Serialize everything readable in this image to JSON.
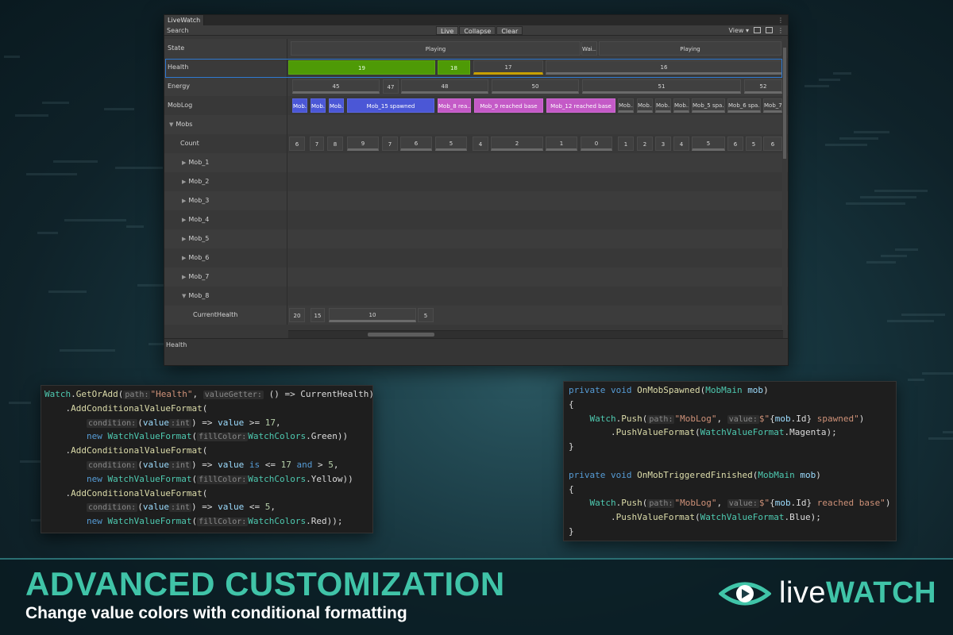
{
  "window": {
    "tab_title": "LiveWatch",
    "search_label": "Search",
    "toolbar": {
      "live": "Live",
      "collapse": "Collapse",
      "clear": "Clear",
      "view": "View ▾"
    },
    "footer_label": "Health",
    "menu_glyph": "⋮"
  },
  "rows": [
    {
      "label": "State",
      "indent": 0,
      "caret": ""
    },
    {
      "label": "Health",
      "indent": 0,
      "caret": ""
    },
    {
      "label": "Energy",
      "indent": 0,
      "caret": ""
    },
    {
      "label": "MobLog",
      "indent": 0,
      "caret": ""
    },
    {
      "label": "Mobs",
      "indent": 1,
      "caret": "▼"
    },
    {
      "label": "Count",
      "indent": 2,
      "caret": ""
    },
    {
      "label": "Mob_1",
      "indent": 3,
      "caret": "▶"
    },
    {
      "label": "Mob_2",
      "indent": 3,
      "caret": "▶"
    },
    {
      "label": "Mob_3",
      "indent": 3,
      "caret": "▶"
    },
    {
      "label": "Mob_4",
      "indent": 3,
      "caret": "▶"
    },
    {
      "label": "Mob_5",
      "indent": 3,
      "caret": "▶"
    },
    {
      "label": "Mob_6",
      "indent": 3,
      "caret": "▶"
    },
    {
      "label": "Mob_7",
      "indent": 3,
      "caret": "▶"
    },
    {
      "label": "Mob_8",
      "indent": 3,
      "caret": "▼"
    },
    {
      "label": "CurrentHealth",
      "indent": 4,
      "caret": ""
    }
  ],
  "cells": {
    "state": [
      {
        "text": "Playing",
        "style": ""
      },
      {
        "text": "Wai...",
        "style": ""
      },
      {
        "text": "Playing",
        "style": ""
      }
    ],
    "health": [
      {
        "text": "19",
        "style": "green"
      },
      {
        "text": "18",
        "style": "green"
      },
      {
        "text": "17",
        "style": "ybar"
      },
      {
        "text": "16",
        "style": "bar"
      }
    ],
    "energy": [
      {
        "text": "45",
        "style": "bar"
      },
      {
        "text": "47",
        "style": ""
      },
      {
        "text": "48",
        "style": "bar"
      },
      {
        "text": "50",
        "style": "bar"
      },
      {
        "text": "51",
        "style": "bar"
      },
      {
        "text": "52",
        "style": "bar"
      }
    ],
    "moblog": [
      {
        "text": "Mob...",
        "style": "blue"
      },
      {
        "text": "Mob...",
        "style": "blue"
      },
      {
        "text": "Mob...",
        "style": "blue"
      },
      {
        "text": "Mob_15 spawned",
        "style": "blue"
      },
      {
        "text": "Mob_8 rea...",
        "style": "magenta"
      },
      {
        "text": "Mob_9 reached base",
        "style": "magenta"
      },
      {
        "text": "Mob_12 reached base",
        "style": "magenta"
      },
      {
        "text": "Mob...",
        "style": "bar"
      },
      {
        "text": "Mob...",
        "style": "bar"
      },
      {
        "text": "Mob...",
        "style": "bar"
      },
      {
        "text": "Mob...",
        "style": "bar"
      },
      {
        "text": "Mob_5 spa...",
        "style": "bar"
      },
      {
        "text": "Mob_6 spa...",
        "style": "bar"
      },
      {
        "text": "Mob_7...",
        "style": "bar"
      }
    ],
    "count": [
      {
        "text": "6",
        "style": ""
      },
      {
        "text": "7",
        "style": ""
      },
      {
        "text": "8",
        "style": ""
      },
      {
        "text": "9",
        "style": "bar"
      },
      {
        "text": "7",
        "style": ""
      },
      {
        "text": "6",
        "style": "bar"
      },
      {
        "text": "5",
        "style": "bar"
      },
      {
        "text": "4",
        "style": ""
      },
      {
        "text": "2",
        "style": "bar"
      },
      {
        "text": "1",
        "style": "bar"
      },
      {
        "text": "0",
        "style": "bar"
      },
      {
        "text": "1",
        "style": ""
      },
      {
        "text": "2",
        "style": ""
      },
      {
        "text": "3",
        "style": ""
      },
      {
        "text": "4",
        "style": ""
      },
      {
        "text": "5",
        "style": "bar"
      },
      {
        "text": "6",
        "style": ""
      },
      {
        "text": "5",
        "style": ""
      },
      {
        "text": "6",
        "style": ""
      }
    ],
    "currenthealth": [
      {
        "text": "20",
        "style": ""
      },
      {
        "text": "15",
        "style": ""
      },
      {
        "text": "10",
        "style": "bar"
      },
      {
        "text": "5",
        "style": ""
      }
    ]
  },
  "code_left": [
    [
      [
        "ty",
        "Watch"
      ],
      [
        "",
        "."
      ],
      [
        "fn",
        "GetOrAdd"
      ],
      [
        "",
        "("
      ],
      [
        "hint",
        "path:"
      ],
      [
        "st",
        "\"Health\""
      ],
      [
        "",
        ", "
      ],
      [
        "hint",
        "valueGetter:"
      ],
      [
        "",
        " () => CurrentHealth)"
      ]
    ],
    [
      [
        "",
        "    ."
      ],
      [
        "fn",
        "AddConditionalValueFormat"
      ],
      [
        "",
        "("
      ]
    ],
    [
      [
        "",
        "        "
      ],
      [
        "hint",
        "condition:"
      ],
      [
        "",
        "("
      ],
      [
        "vr",
        "value"
      ],
      [
        "hint",
        ":int"
      ],
      [
        "",
        ") => "
      ],
      [
        "vr",
        "value"
      ],
      [
        "",
        " >= "
      ],
      [
        "nm",
        "17"
      ],
      [
        "",
        ","
      ]
    ],
    [
      [
        "",
        "        "
      ],
      [
        "kw",
        "new "
      ],
      [
        "ty",
        "WatchValueFormat"
      ],
      [
        "",
        "("
      ],
      [
        "hint",
        "fillColor:"
      ],
      [
        "ty",
        "WatchColors"
      ],
      [
        "",
        ".Green))"
      ]
    ],
    [
      [
        "",
        "    ."
      ],
      [
        "fn",
        "AddConditionalValueFormat"
      ],
      [
        "",
        "("
      ]
    ],
    [
      [
        "",
        "        "
      ],
      [
        "hint",
        "condition:"
      ],
      [
        "",
        "("
      ],
      [
        "vr",
        "value"
      ],
      [
        "hint",
        ":int"
      ],
      [
        "",
        ") => "
      ],
      [
        "vr",
        "value"
      ],
      [
        "",
        ""
      ],
      [
        "kw",
        " is"
      ],
      [
        "",
        " <= "
      ],
      [
        "nm",
        "17"
      ],
      [
        "kw",
        " and"
      ],
      [
        "",
        " > "
      ],
      [
        "nm",
        "5"
      ],
      [
        "",
        ","
      ]
    ],
    [
      [
        "",
        "        "
      ],
      [
        "kw",
        "new "
      ],
      [
        "ty",
        "WatchValueFormat"
      ],
      [
        "",
        "("
      ],
      [
        "hint",
        "fillColor:"
      ],
      [
        "ty",
        "WatchColors"
      ],
      [
        "",
        ".Yellow))"
      ]
    ],
    [
      [
        "",
        "    ."
      ],
      [
        "fn",
        "AddConditionalValueFormat"
      ],
      [
        "",
        "("
      ]
    ],
    [
      [
        "",
        "        "
      ],
      [
        "hint",
        "condition:"
      ],
      [
        "",
        "("
      ],
      [
        "vr",
        "value"
      ],
      [
        "hint",
        ":int"
      ],
      [
        "",
        ") => "
      ],
      [
        "vr",
        "value"
      ],
      [
        "",
        " <= "
      ],
      [
        "nm",
        "5"
      ],
      [
        "",
        ","
      ]
    ],
    [
      [
        "",
        "        "
      ],
      [
        "kw",
        "new "
      ],
      [
        "ty",
        "WatchValueFormat"
      ],
      [
        "",
        "("
      ],
      [
        "hint",
        "fillColor:"
      ],
      [
        "ty",
        "WatchColors"
      ],
      [
        "",
        ".Red));"
      ]
    ]
  ],
  "code_right": [
    [
      [
        "kw",
        "private void "
      ],
      [
        "fn",
        "OnMobSpawned"
      ],
      [
        "",
        "("
      ],
      [
        "ty",
        "MobMain"
      ],
      [
        "",
        " "
      ],
      [
        "vr",
        "mob"
      ],
      [
        "",
        ")"
      ]
    ],
    [
      [
        "",
        "{"
      ]
    ],
    [
      [
        "",
        "    "
      ],
      [
        "ty",
        "Watch"
      ],
      [
        "",
        "."
      ],
      [
        "fn",
        "Push"
      ],
      [
        "",
        "("
      ],
      [
        "hint",
        "path:"
      ],
      [
        "st",
        "\"MobLog\""
      ],
      [
        "",
        ", "
      ],
      [
        "hint",
        "value:"
      ],
      [
        "st",
        "$\""
      ],
      [
        "",
        "{"
      ],
      [
        "vr",
        "mob"
      ],
      [
        "",
        ".Id}"
      ],
      [
        "st",
        " spawned\""
      ],
      [
        "",
        ")"
      ]
    ],
    [
      [
        "",
        "        ."
      ],
      [
        "fn",
        "PushValueFormat"
      ],
      [
        "",
        "("
      ],
      [
        "ty",
        "WatchValueFormat"
      ],
      [
        "",
        ".Magenta);"
      ]
    ],
    [
      [
        "",
        "}"
      ]
    ],
    [
      [
        "",
        ""
      ]
    ],
    [
      [
        "kw",
        "private void "
      ],
      [
        "fn",
        "OnMobTriggeredFinished"
      ],
      [
        "",
        "("
      ],
      [
        "ty",
        "MobMain"
      ],
      [
        "",
        " "
      ],
      [
        "vr",
        "mob"
      ],
      [
        "",
        ")"
      ]
    ],
    [
      [
        "",
        "{"
      ]
    ],
    [
      [
        "",
        "    "
      ],
      [
        "ty",
        "Watch"
      ],
      [
        "",
        "."
      ],
      [
        "fn",
        "Push"
      ],
      [
        "",
        "("
      ],
      [
        "hint",
        "path:"
      ],
      [
        "st",
        "\"MobLog\""
      ],
      [
        "",
        ", "
      ],
      [
        "hint",
        "value:"
      ],
      [
        "st",
        "$\""
      ],
      [
        "",
        "{"
      ],
      [
        "vr",
        "mob"
      ],
      [
        "",
        ".Id}"
      ],
      [
        "st",
        " reached base\""
      ],
      [
        "",
        ")"
      ]
    ],
    [
      [
        "",
        "        ."
      ],
      [
        "fn",
        "PushValueFormat"
      ],
      [
        "",
        "("
      ],
      [
        "ty",
        "WatchValueFormat"
      ],
      [
        "",
        ".Blue);"
      ]
    ],
    [
      [
        "",
        "}"
      ]
    ]
  ],
  "banner": {
    "headline": "ADVANCED CUSTOMIZATION",
    "subline": "Change value colors with conditional formatting",
    "logo_light": "live",
    "logo_bold": "WATCH"
  },
  "colors": {
    "accent": "#40c4a8",
    "green": "#4e9a06",
    "magenta": "#c45ac7",
    "blue": "#4b57d6",
    "yellow": "#c8a000"
  }
}
